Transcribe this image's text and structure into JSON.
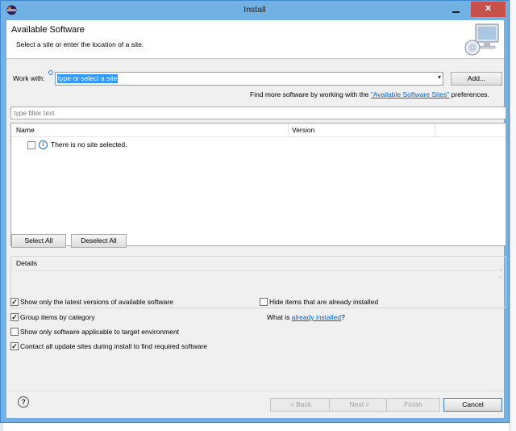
{
  "window": {
    "title": "Install",
    "close_glyph": "✕"
  },
  "header": {
    "title": "Available Software",
    "subtitle": "Select a site or enter the location of a site."
  },
  "work_with": {
    "label": "Work with:",
    "value": "type or select a site",
    "add_button": "Add..."
  },
  "find_more": {
    "prefix": "Find more software by working with the ",
    "link": "\"Available Software Sites\"",
    "suffix": " preferences."
  },
  "filter": {
    "placeholder": "type filter text"
  },
  "table": {
    "columns": [
      "Name",
      "Version"
    ],
    "message": "There is no site selected."
  },
  "selection_buttons": {
    "select_all": "Select All",
    "deselect_all": "Deselect All"
  },
  "details": {
    "label": "Details"
  },
  "options": [
    {
      "label": "Show only the latest versions of available software",
      "checked": true
    },
    {
      "label": "Group items by category",
      "checked": true
    },
    {
      "label": "Show only software applicable to target environment",
      "checked": false
    },
    {
      "label": "Contact all update sites during install to find required software",
      "checked": true
    },
    {
      "label": "Hide items that are already installed",
      "checked": false
    }
  ],
  "already_installed": {
    "prefix": "What is ",
    "link": "already installed",
    "suffix": "?"
  },
  "footer": {
    "help_glyph": "?",
    "back": "< Back",
    "next": "Next >",
    "finish": "Finish",
    "cancel": "Cancel"
  },
  "icons": {
    "app": "eclipse-icon",
    "header_image": "computer-install-icon",
    "info": "info-icon",
    "help": "help-icon"
  }
}
